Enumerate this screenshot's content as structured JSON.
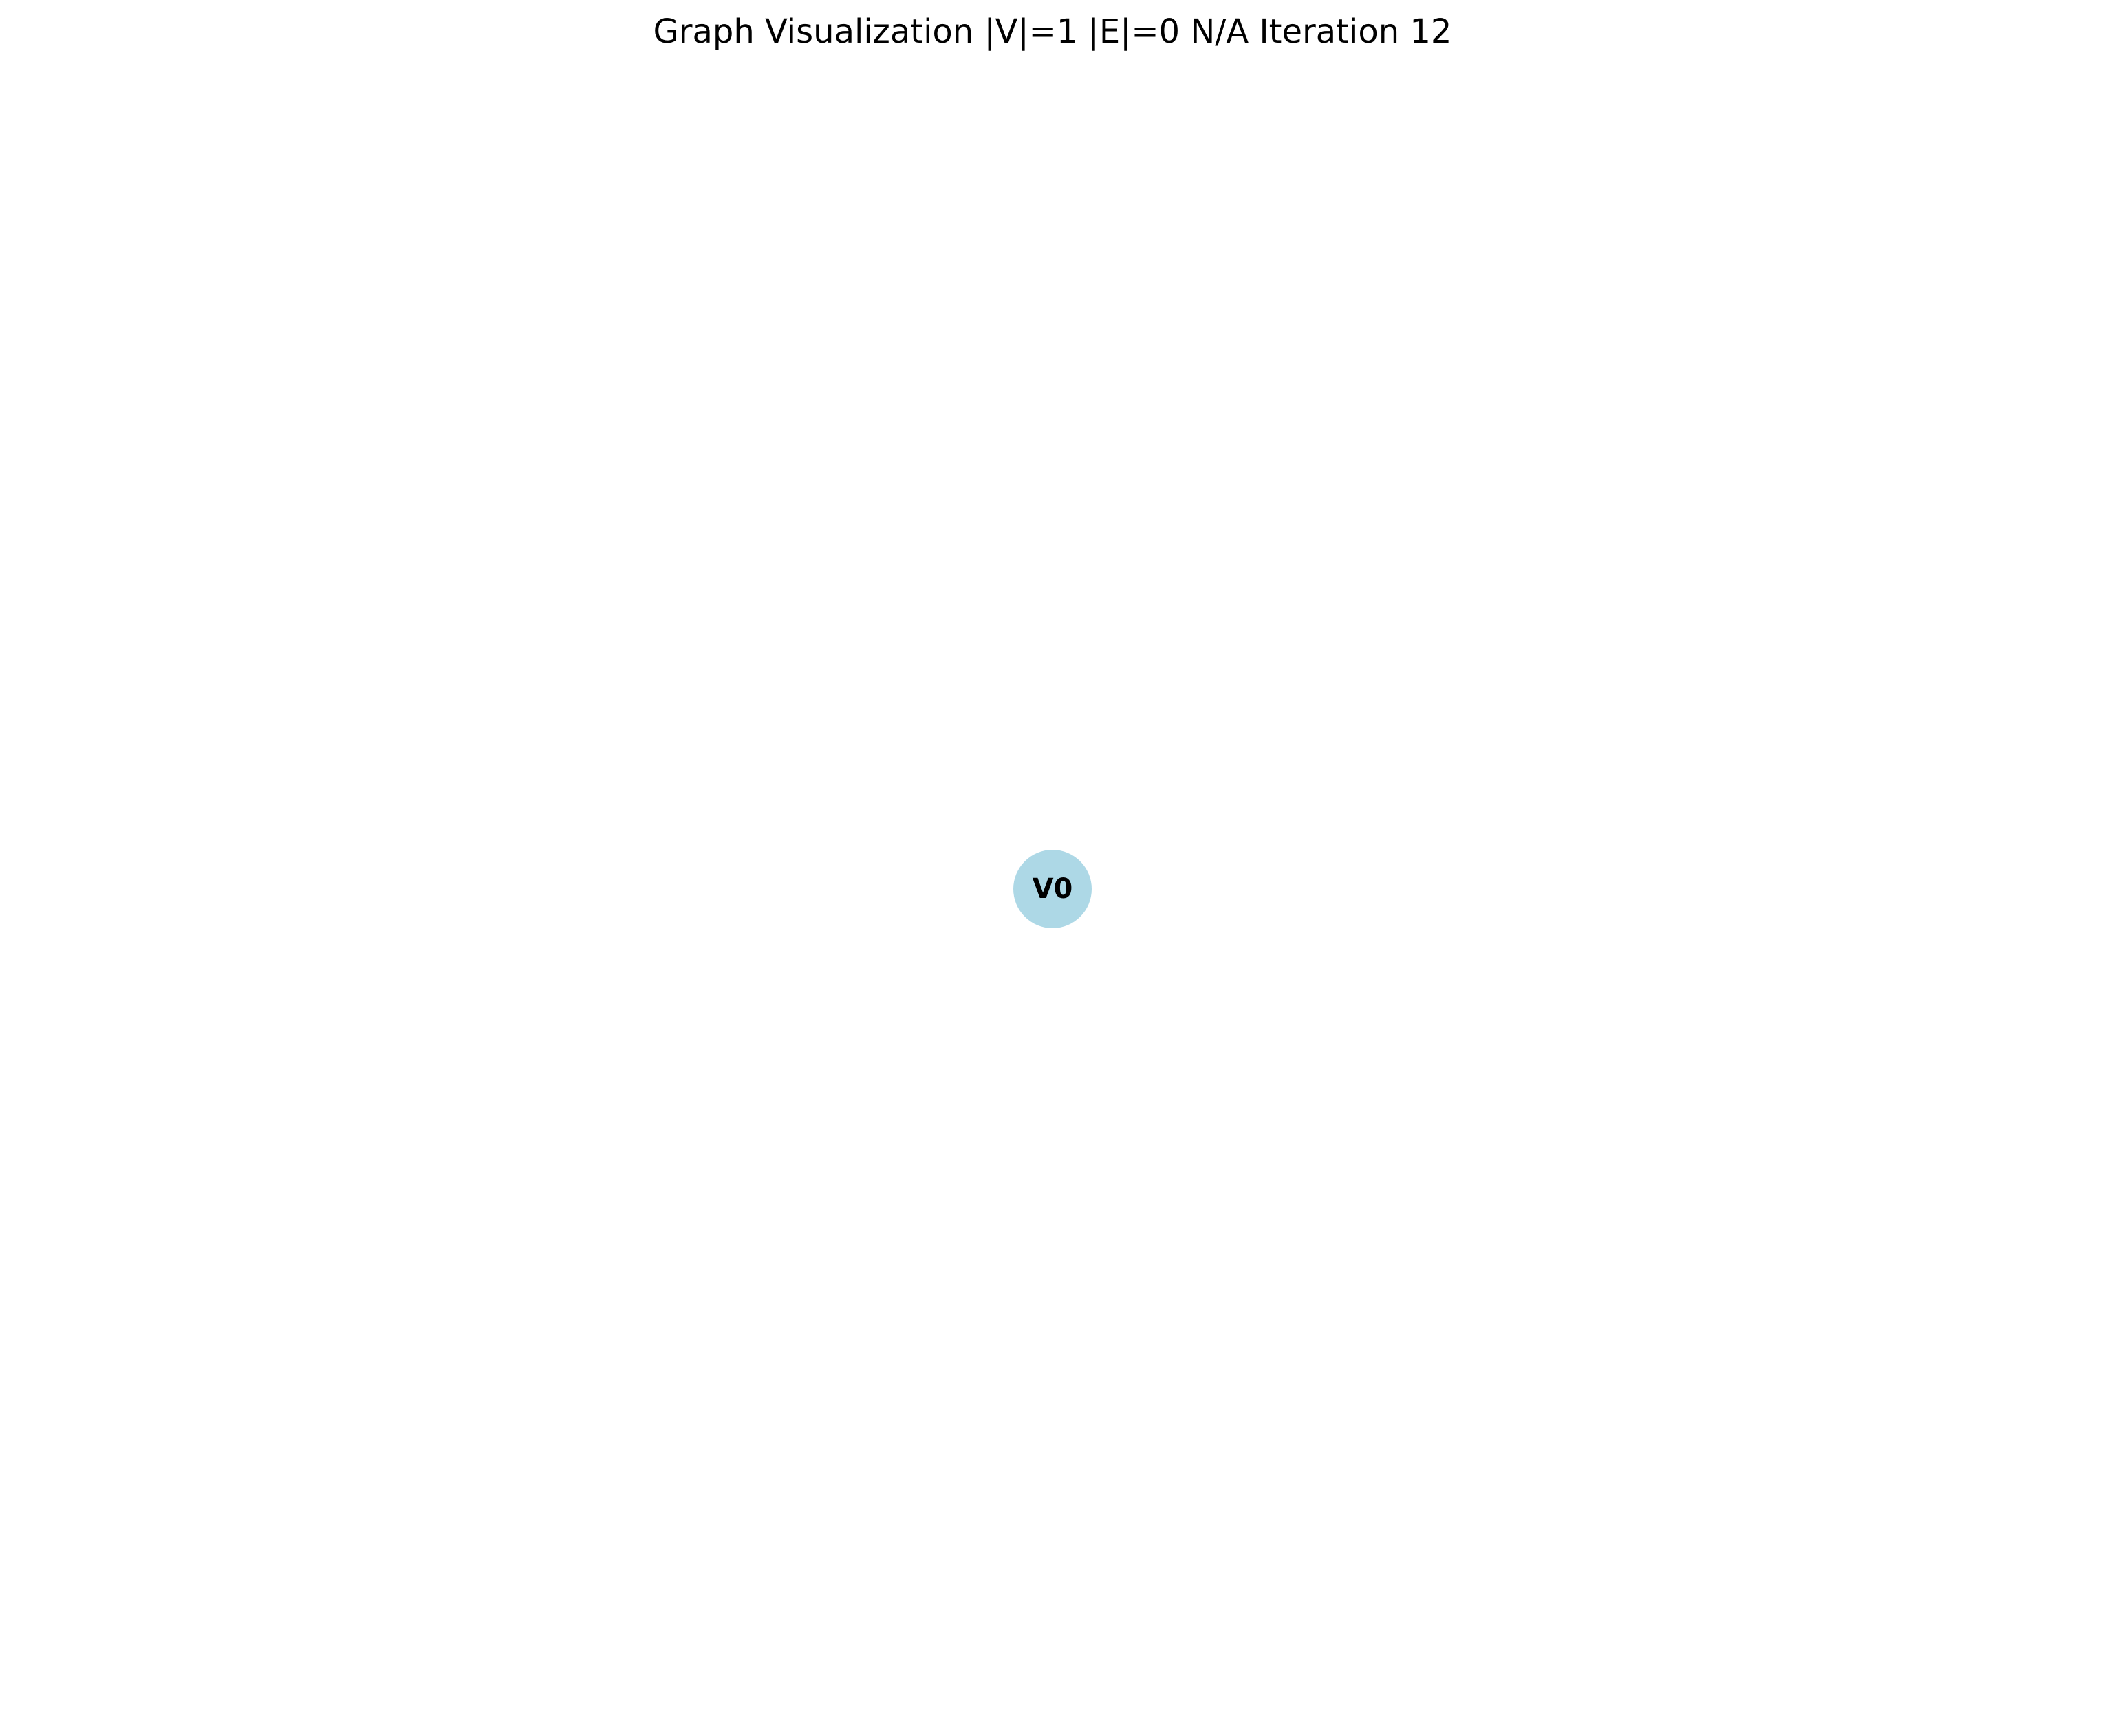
{
  "title": "Graph Visualization |V|=1 |E|=0 N/A Iteration 12",
  "colors": {
    "background": "#ffffff",
    "node_fill": "#add8e6",
    "node_label": "#000000",
    "title_text": "#000000"
  },
  "graph": {
    "nodes": [
      {
        "id": "V0",
        "label": "V0"
      }
    ],
    "edges": []
  }
}
